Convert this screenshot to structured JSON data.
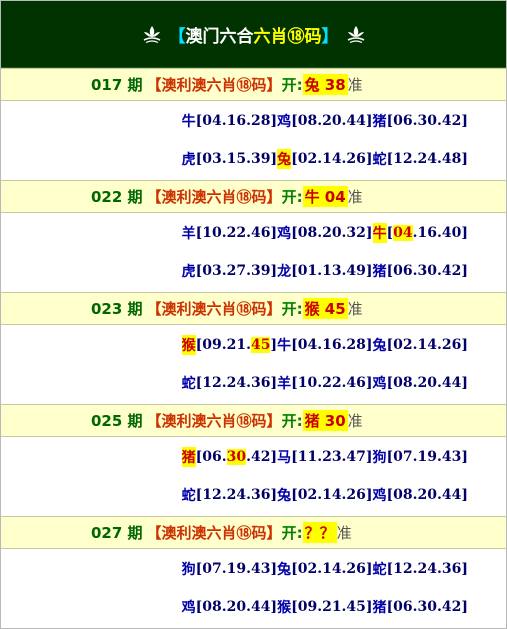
{
  "header": {
    "bracket_open": "【",
    "title_main": "澳门六合",
    "title_highlight": "六肖⑱码",
    "bracket_close": "】"
  },
  "rows": [
    {
      "period": "017 期",
      "label": "【澳利澳六肖⑱码】",
      "kai": "开:",
      "result": "兔 38",
      "zhun": "准",
      "line1": [
        {
          "t": "牛",
          "cls": "z"
        },
        {
          "t": "[04.16.28]",
          "cls": ""
        },
        {
          "t": "鸡",
          "cls": "z"
        },
        {
          "t": "[08.20.44]",
          "cls": ""
        },
        {
          "t": "猪",
          "cls": "z"
        },
        {
          "t": "[06.30.42]",
          "cls": ""
        }
      ],
      "line2": [
        {
          "t": "虎",
          "cls": "z"
        },
        {
          "t": "[03.15.39]",
          "cls": ""
        },
        {
          "t": "兔",
          "cls": "hl"
        },
        {
          "t": "[02.14.26]",
          "cls": ""
        },
        {
          "t": "蛇",
          "cls": "z"
        },
        {
          "t": "[12.24.48]",
          "cls": ""
        }
      ]
    },
    {
      "period": "022 期",
      "label": "【澳利澳六肖⑱码】",
      "kai": "开:",
      "result": "牛 04",
      "zhun": "准",
      "line1": [
        {
          "t": "羊",
          "cls": "z"
        },
        {
          "t": "[10.22.46]",
          "cls": ""
        },
        {
          "t": "鸡",
          "cls": "z"
        },
        {
          "t": "[08.20.32]",
          "cls": ""
        },
        {
          "t": "牛",
          "cls": "hl"
        },
        {
          "t": "[",
          "cls": ""
        },
        {
          "t": "04",
          "cls": "hlr"
        },
        {
          "t": ".16.40]",
          "cls": ""
        }
      ],
      "line2": [
        {
          "t": "虎",
          "cls": "z"
        },
        {
          "t": "[03.27.39]",
          "cls": ""
        },
        {
          "t": "龙",
          "cls": "z"
        },
        {
          "t": "[01.13.49]",
          "cls": ""
        },
        {
          "t": "猪",
          "cls": "z"
        },
        {
          "t": "[06.30.42]",
          "cls": ""
        }
      ]
    },
    {
      "period": "023 期",
      "label": "【澳利澳六肖⑱码】",
      "kai": "开:",
      "result": "猴 45",
      "zhun": "准",
      "line1": [
        {
          "t": "猴",
          "cls": "hl"
        },
        {
          "t": "[09.21.",
          "cls": ""
        },
        {
          "t": "45",
          "cls": "hlr"
        },
        {
          "t": "]",
          "cls": ""
        },
        {
          "t": "牛",
          "cls": "z"
        },
        {
          "t": "[04.16.28]",
          "cls": ""
        },
        {
          "t": "兔",
          "cls": "z"
        },
        {
          "t": "[02.14.26]",
          "cls": ""
        }
      ],
      "line2": [
        {
          "t": "蛇",
          "cls": "z"
        },
        {
          "t": "[12.24.36]",
          "cls": ""
        },
        {
          "t": "羊",
          "cls": "z"
        },
        {
          "t": "[10.22.46]",
          "cls": ""
        },
        {
          "t": "鸡",
          "cls": "z"
        },
        {
          "t": "[08.20.44]",
          "cls": ""
        }
      ]
    },
    {
      "period": "025 期",
      "label": "【澳利澳六肖⑱码】",
      "kai": "开:",
      "result": "猪 30",
      "zhun": "准",
      "line1": [
        {
          "t": "猪",
          "cls": "hl"
        },
        {
          "t": "[06.",
          "cls": ""
        },
        {
          "t": "30",
          "cls": "hlr"
        },
        {
          "t": ".42]",
          "cls": ""
        },
        {
          "t": "马",
          "cls": "z"
        },
        {
          "t": "[11.23.47]",
          "cls": ""
        },
        {
          "t": "狗",
          "cls": "z"
        },
        {
          "t": "[07.19.43]",
          "cls": ""
        }
      ],
      "line2": [
        {
          "t": "蛇",
          "cls": "z"
        },
        {
          "t": "[12.24.36]",
          "cls": ""
        },
        {
          "t": "兔",
          "cls": "z"
        },
        {
          "t": "[02.14.26]",
          "cls": ""
        },
        {
          "t": "鸡",
          "cls": "z"
        },
        {
          "t": "[08.20.44]",
          "cls": ""
        }
      ]
    },
    {
      "period": "027 期",
      "label": "【澳利澳六肖⑱码】",
      "kai": "开:",
      "result": "？？",
      "zhun": "准",
      "line1": [
        {
          "t": "狗",
          "cls": "z"
        },
        {
          "t": "[07.19.43]",
          "cls": ""
        },
        {
          "t": "兔",
          "cls": "z"
        },
        {
          "t": "[02.14.26]",
          "cls": ""
        },
        {
          "t": "蛇",
          "cls": "z"
        },
        {
          "t": "[12.24.36]",
          "cls": ""
        }
      ],
      "line2": [
        {
          "t": "鸡",
          "cls": "z"
        },
        {
          "t": "[08.20.44]",
          "cls": ""
        },
        {
          "t": "猴",
          "cls": "z"
        },
        {
          "t": "[09.21.45]",
          "cls": ""
        },
        {
          "t": "猪",
          "cls": "z"
        },
        {
          "t": "[06.30.42]",
          "cls": ""
        }
      ]
    }
  ]
}
